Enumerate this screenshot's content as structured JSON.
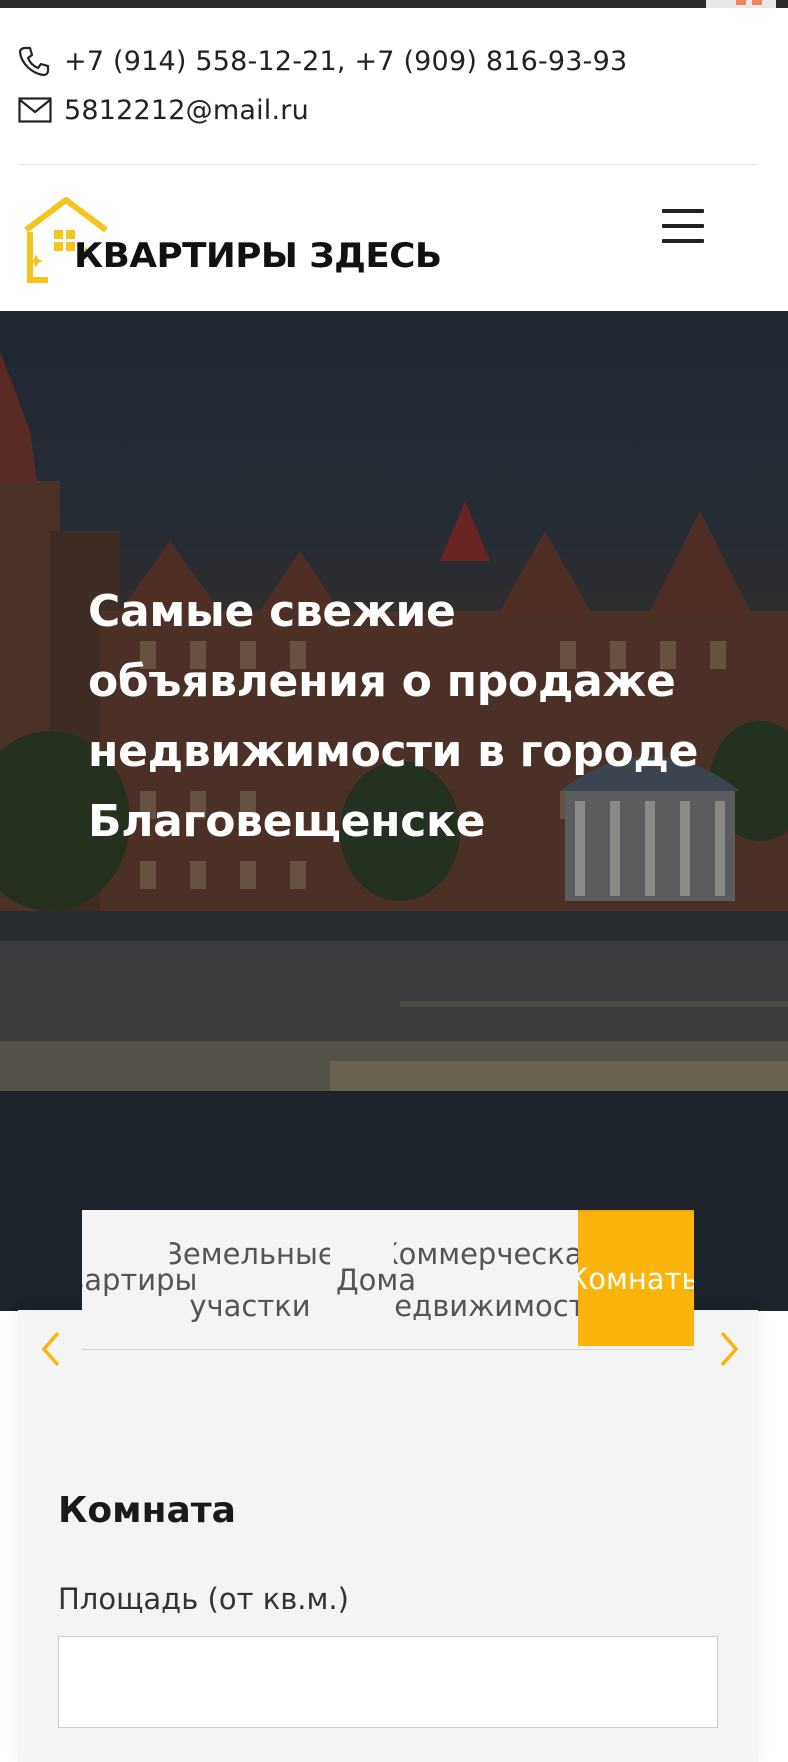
{
  "header": {
    "phones": "+7 (914) 558-12-21, +7 (909) 816-93-93",
    "email": "5812212@mail.ru",
    "logo_text": "КВАРТИРЫ ЗДЕСЬ"
  },
  "hero": {
    "title": "Самые свежие объявления о продаже недвижимости в городе Благовещенске"
  },
  "tabs": [
    {
      "label": "Квартиры"
    },
    {
      "label": "Земельные участки"
    },
    {
      "label": "Дома"
    },
    {
      "label": "Коммерческая недвижимость"
    },
    {
      "label": "Комнаты",
      "active": true
    }
  ],
  "form": {
    "title": "Комната",
    "area_label": "Площадь (от кв.м.)",
    "area_value": ""
  },
  "colors": {
    "accent": "#fbb40c",
    "dark": "#222222"
  },
  "icons": {
    "phone": "phone-icon",
    "email": "envelope-icon",
    "menu": "hamburger-menu-icon",
    "prev": "chevron-left-icon",
    "next": "chevron-right-icon"
  }
}
